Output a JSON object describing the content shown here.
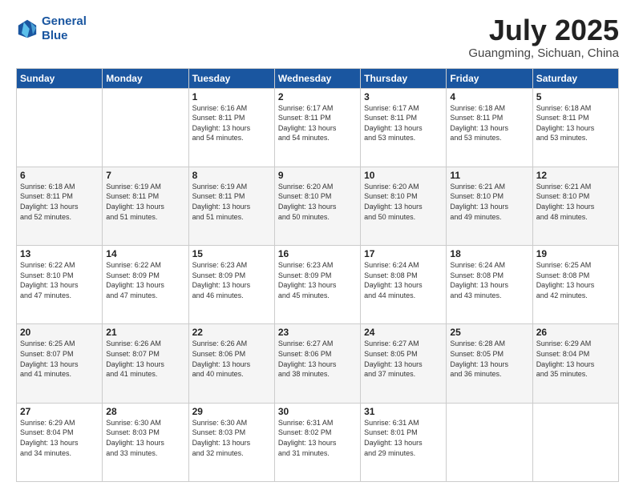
{
  "header": {
    "logo_line1": "General",
    "logo_line2": "Blue",
    "month": "July 2025",
    "location": "Guangming, Sichuan, China"
  },
  "days_of_week": [
    "Sunday",
    "Monday",
    "Tuesday",
    "Wednesday",
    "Thursday",
    "Friday",
    "Saturday"
  ],
  "weeks": [
    [
      {
        "num": "",
        "info": ""
      },
      {
        "num": "",
        "info": ""
      },
      {
        "num": "1",
        "info": "Sunrise: 6:16 AM\nSunset: 8:11 PM\nDaylight: 13 hours\nand 54 minutes."
      },
      {
        "num": "2",
        "info": "Sunrise: 6:17 AM\nSunset: 8:11 PM\nDaylight: 13 hours\nand 54 minutes."
      },
      {
        "num": "3",
        "info": "Sunrise: 6:17 AM\nSunset: 8:11 PM\nDaylight: 13 hours\nand 53 minutes."
      },
      {
        "num": "4",
        "info": "Sunrise: 6:18 AM\nSunset: 8:11 PM\nDaylight: 13 hours\nand 53 minutes."
      },
      {
        "num": "5",
        "info": "Sunrise: 6:18 AM\nSunset: 8:11 PM\nDaylight: 13 hours\nand 53 minutes."
      }
    ],
    [
      {
        "num": "6",
        "info": "Sunrise: 6:18 AM\nSunset: 8:11 PM\nDaylight: 13 hours\nand 52 minutes."
      },
      {
        "num": "7",
        "info": "Sunrise: 6:19 AM\nSunset: 8:11 PM\nDaylight: 13 hours\nand 51 minutes."
      },
      {
        "num": "8",
        "info": "Sunrise: 6:19 AM\nSunset: 8:11 PM\nDaylight: 13 hours\nand 51 minutes."
      },
      {
        "num": "9",
        "info": "Sunrise: 6:20 AM\nSunset: 8:10 PM\nDaylight: 13 hours\nand 50 minutes."
      },
      {
        "num": "10",
        "info": "Sunrise: 6:20 AM\nSunset: 8:10 PM\nDaylight: 13 hours\nand 50 minutes."
      },
      {
        "num": "11",
        "info": "Sunrise: 6:21 AM\nSunset: 8:10 PM\nDaylight: 13 hours\nand 49 minutes."
      },
      {
        "num": "12",
        "info": "Sunrise: 6:21 AM\nSunset: 8:10 PM\nDaylight: 13 hours\nand 48 minutes."
      }
    ],
    [
      {
        "num": "13",
        "info": "Sunrise: 6:22 AM\nSunset: 8:10 PM\nDaylight: 13 hours\nand 47 minutes."
      },
      {
        "num": "14",
        "info": "Sunrise: 6:22 AM\nSunset: 8:09 PM\nDaylight: 13 hours\nand 47 minutes."
      },
      {
        "num": "15",
        "info": "Sunrise: 6:23 AM\nSunset: 8:09 PM\nDaylight: 13 hours\nand 46 minutes."
      },
      {
        "num": "16",
        "info": "Sunrise: 6:23 AM\nSunset: 8:09 PM\nDaylight: 13 hours\nand 45 minutes."
      },
      {
        "num": "17",
        "info": "Sunrise: 6:24 AM\nSunset: 8:08 PM\nDaylight: 13 hours\nand 44 minutes."
      },
      {
        "num": "18",
        "info": "Sunrise: 6:24 AM\nSunset: 8:08 PM\nDaylight: 13 hours\nand 43 minutes."
      },
      {
        "num": "19",
        "info": "Sunrise: 6:25 AM\nSunset: 8:08 PM\nDaylight: 13 hours\nand 42 minutes."
      }
    ],
    [
      {
        "num": "20",
        "info": "Sunrise: 6:25 AM\nSunset: 8:07 PM\nDaylight: 13 hours\nand 41 minutes."
      },
      {
        "num": "21",
        "info": "Sunrise: 6:26 AM\nSunset: 8:07 PM\nDaylight: 13 hours\nand 41 minutes."
      },
      {
        "num": "22",
        "info": "Sunrise: 6:26 AM\nSunset: 8:06 PM\nDaylight: 13 hours\nand 40 minutes."
      },
      {
        "num": "23",
        "info": "Sunrise: 6:27 AM\nSunset: 8:06 PM\nDaylight: 13 hours\nand 38 minutes."
      },
      {
        "num": "24",
        "info": "Sunrise: 6:27 AM\nSunset: 8:05 PM\nDaylight: 13 hours\nand 37 minutes."
      },
      {
        "num": "25",
        "info": "Sunrise: 6:28 AM\nSunset: 8:05 PM\nDaylight: 13 hours\nand 36 minutes."
      },
      {
        "num": "26",
        "info": "Sunrise: 6:29 AM\nSunset: 8:04 PM\nDaylight: 13 hours\nand 35 minutes."
      }
    ],
    [
      {
        "num": "27",
        "info": "Sunrise: 6:29 AM\nSunset: 8:04 PM\nDaylight: 13 hours\nand 34 minutes."
      },
      {
        "num": "28",
        "info": "Sunrise: 6:30 AM\nSunset: 8:03 PM\nDaylight: 13 hours\nand 33 minutes."
      },
      {
        "num": "29",
        "info": "Sunrise: 6:30 AM\nSunset: 8:03 PM\nDaylight: 13 hours\nand 32 minutes."
      },
      {
        "num": "30",
        "info": "Sunrise: 6:31 AM\nSunset: 8:02 PM\nDaylight: 13 hours\nand 31 minutes."
      },
      {
        "num": "31",
        "info": "Sunrise: 6:31 AM\nSunset: 8:01 PM\nDaylight: 13 hours\nand 29 minutes."
      },
      {
        "num": "",
        "info": ""
      },
      {
        "num": "",
        "info": ""
      }
    ]
  ]
}
